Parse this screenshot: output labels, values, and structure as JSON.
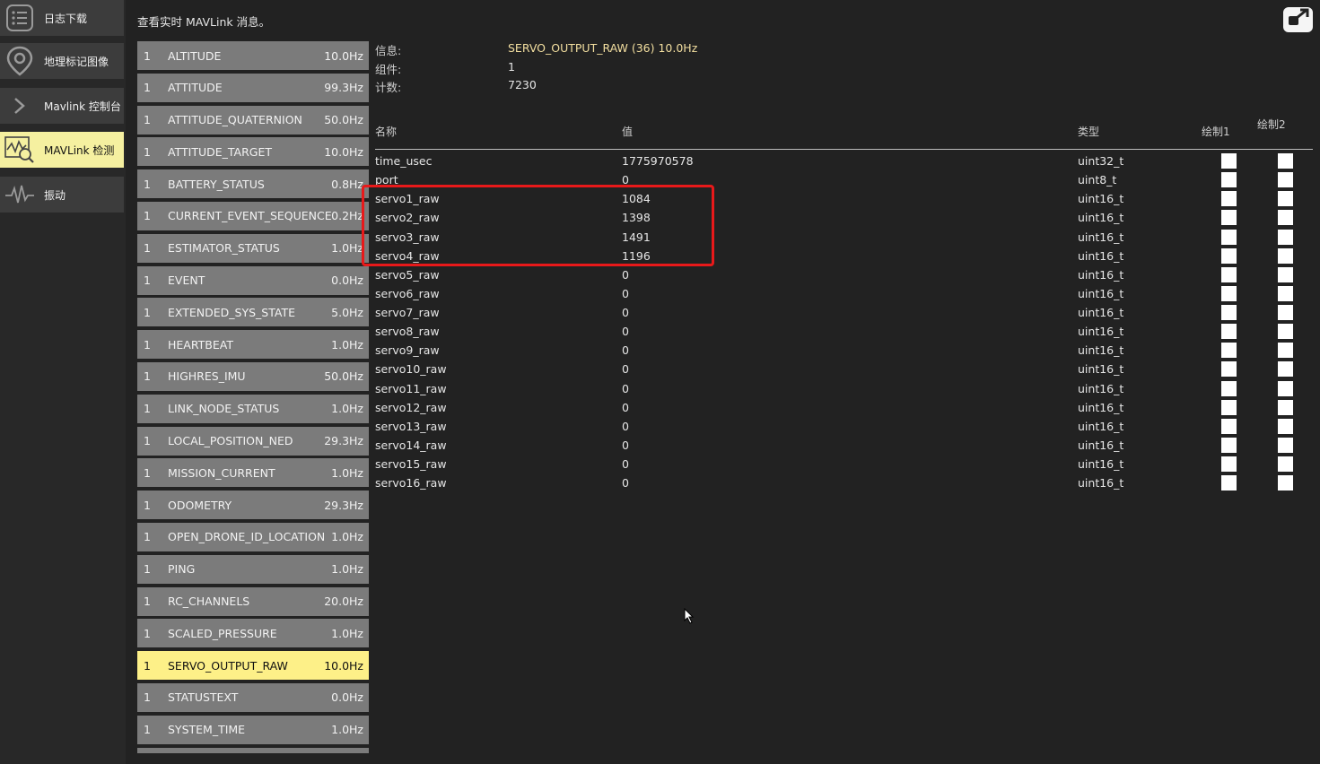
{
  "sidebar": {
    "items": [
      {
        "label": "日志下载",
        "icon": "list-icon",
        "active": false
      },
      {
        "label": "地理标记图像",
        "icon": "map-pin-icon",
        "active": false
      },
      {
        "label": "Mavlink 控制台",
        "icon": "chevron-right-icon",
        "active": false
      },
      {
        "label": "MAVLink 检测",
        "icon": "signal-inspect-icon",
        "active": true
      },
      {
        "label": "振动",
        "icon": "waveform-icon",
        "active": false
      }
    ]
  },
  "header": {
    "hint": "查看实时 MAVLink 消息。",
    "popout_icon": "popout-window-icon"
  },
  "messages": [
    {
      "comp": "1",
      "name": "ALTITUDE",
      "rate": "10.0Hz"
    },
    {
      "comp": "1",
      "name": "ATTITUDE",
      "rate": "99.3Hz"
    },
    {
      "comp": "1",
      "name": "ATTITUDE_QUATERNION",
      "rate": "50.0Hz"
    },
    {
      "comp": "1",
      "name": "ATTITUDE_TARGET",
      "rate": "10.0Hz"
    },
    {
      "comp": "1",
      "name": "BATTERY_STATUS",
      "rate": "0.8Hz"
    },
    {
      "comp": "1",
      "name": "CURRENT_EVENT_SEQUENCE",
      "rate": "0.2Hz"
    },
    {
      "comp": "1",
      "name": "ESTIMATOR_STATUS",
      "rate": "1.0Hz"
    },
    {
      "comp": "1",
      "name": "EVENT",
      "rate": "0.0Hz"
    },
    {
      "comp": "1",
      "name": "EXTENDED_SYS_STATE",
      "rate": "5.0Hz"
    },
    {
      "comp": "1",
      "name": "HEARTBEAT",
      "rate": "1.0Hz"
    },
    {
      "comp": "1",
      "name": "HIGHRES_IMU",
      "rate": "50.0Hz"
    },
    {
      "comp": "1",
      "name": "LINK_NODE_STATUS",
      "rate": "1.0Hz"
    },
    {
      "comp": "1",
      "name": "LOCAL_POSITION_NED",
      "rate": "29.3Hz"
    },
    {
      "comp": "1",
      "name": "MISSION_CURRENT",
      "rate": "1.0Hz"
    },
    {
      "comp": "1",
      "name": "ODOMETRY",
      "rate": "29.3Hz"
    },
    {
      "comp": "1",
      "name": "OPEN_DRONE_ID_LOCATION",
      "rate": "1.0Hz"
    },
    {
      "comp": "1",
      "name": "PING",
      "rate": "1.0Hz"
    },
    {
      "comp": "1",
      "name": "RC_CHANNELS",
      "rate": "20.0Hz"
    },
    {
      "comp": "1",
      "name": "SCALED_PRESSURE",
      "rate": "1.0Hz"
    },
    {
      "comp": "1",
      "name": "SERVO_OUTPUT_RAW",
      "rate": "10.0Hz",
      "selected": true
    },
    {
      "comp": "1",
      "name": "STATUSTEXT",
      "rate": "0.0Hz"
    },
    {
      "comp": "1",
      "name": "SYSTEM_TIME",
      "rate": "1.0Hz"
    },
    {
      "comp": "",
      "name": "",
      "rate": ""
    }
  ],
  "details": {
    "info_label": "信息:",
    "info_value": "SERVO_OUTPUT_RAW (36) 10.0Hz",
    "component_label": "组件:",
    "component_value": "1",
    "count_label": "计数:",
    "count_value": "7230"
  },
  "table": {
    "headers": {
      "name": "名称",
      "value": "值",
      "type": "类型",
      "plot1": "绘制1",
      "plot2": "绘制2"
    },
    "rows": [
      {
        "name": "time_usec",
        "value": "1775970578",
        "type": "uint32_t"
      },
      {
        "name": "port",
        "value": "0",
        "type": "uint8_t"
      },
      {
        "name": "servo1_raw",
        "value": "1084",
        "type": "uint16_t"
      },
      {
        "name": "servo2_raw",
        "value": "1398",
        "type": "uint16_t"
      },
      {
        "name": "servo3_raw",
        "value": "1491",
        "type": "uint16_t"
      },
      {
        "name": "servo4_raw",
        "value": "1196",
        "type": "uint16_t"
      },
      {
        "name": "servo5_raw",
        "value": "0",
        "type": "uint16_t"
      },
      {
        "name": "servo6_raw",
        "value": "0",
        "type": "uint16_t"
      },
      {
        "name": "servo7_raw",
        "value": "0",
        "type": "uint16_t"
      },
      {
        "name": "servo8_raw",
        "value": "0",
        "type": "uint16_t"
      },
      {
        "name": "servo9_raw",
        "value": "0",
        "type": "uint16_t"
      },
      {
        "name": "servo10_raw",
        "value": "0",
        "type": "uint16_t"
      },
      {
        "name": "servo11_raw",
        "value": "0",
        "type": "uint16_t"
      },
      {
        "name": "servo12_raw",
        "value": "0",
        "type": "uint16_t"
      },
      {
        "name": "servo13_raw",
        "value": "0",
        "type": "uint16_t"
      },
      {
        "name": "servo14_raw",
        "value": "0",
        "type": "uint16_t"
      },
      {
        "name": "servo15_raw",
        "value": "0",
        "type": "uint16_t"
      },
      {
        "name": "servo16_raw",
        "value": "0",
        "type": "uint16_t"
      }
    ]
  },
  "colors": {
    "selected_bg": "#fdf088",
    "highlight_border": "#e8191a",
    "accent_text": "#f3dfa0"
  }
}
